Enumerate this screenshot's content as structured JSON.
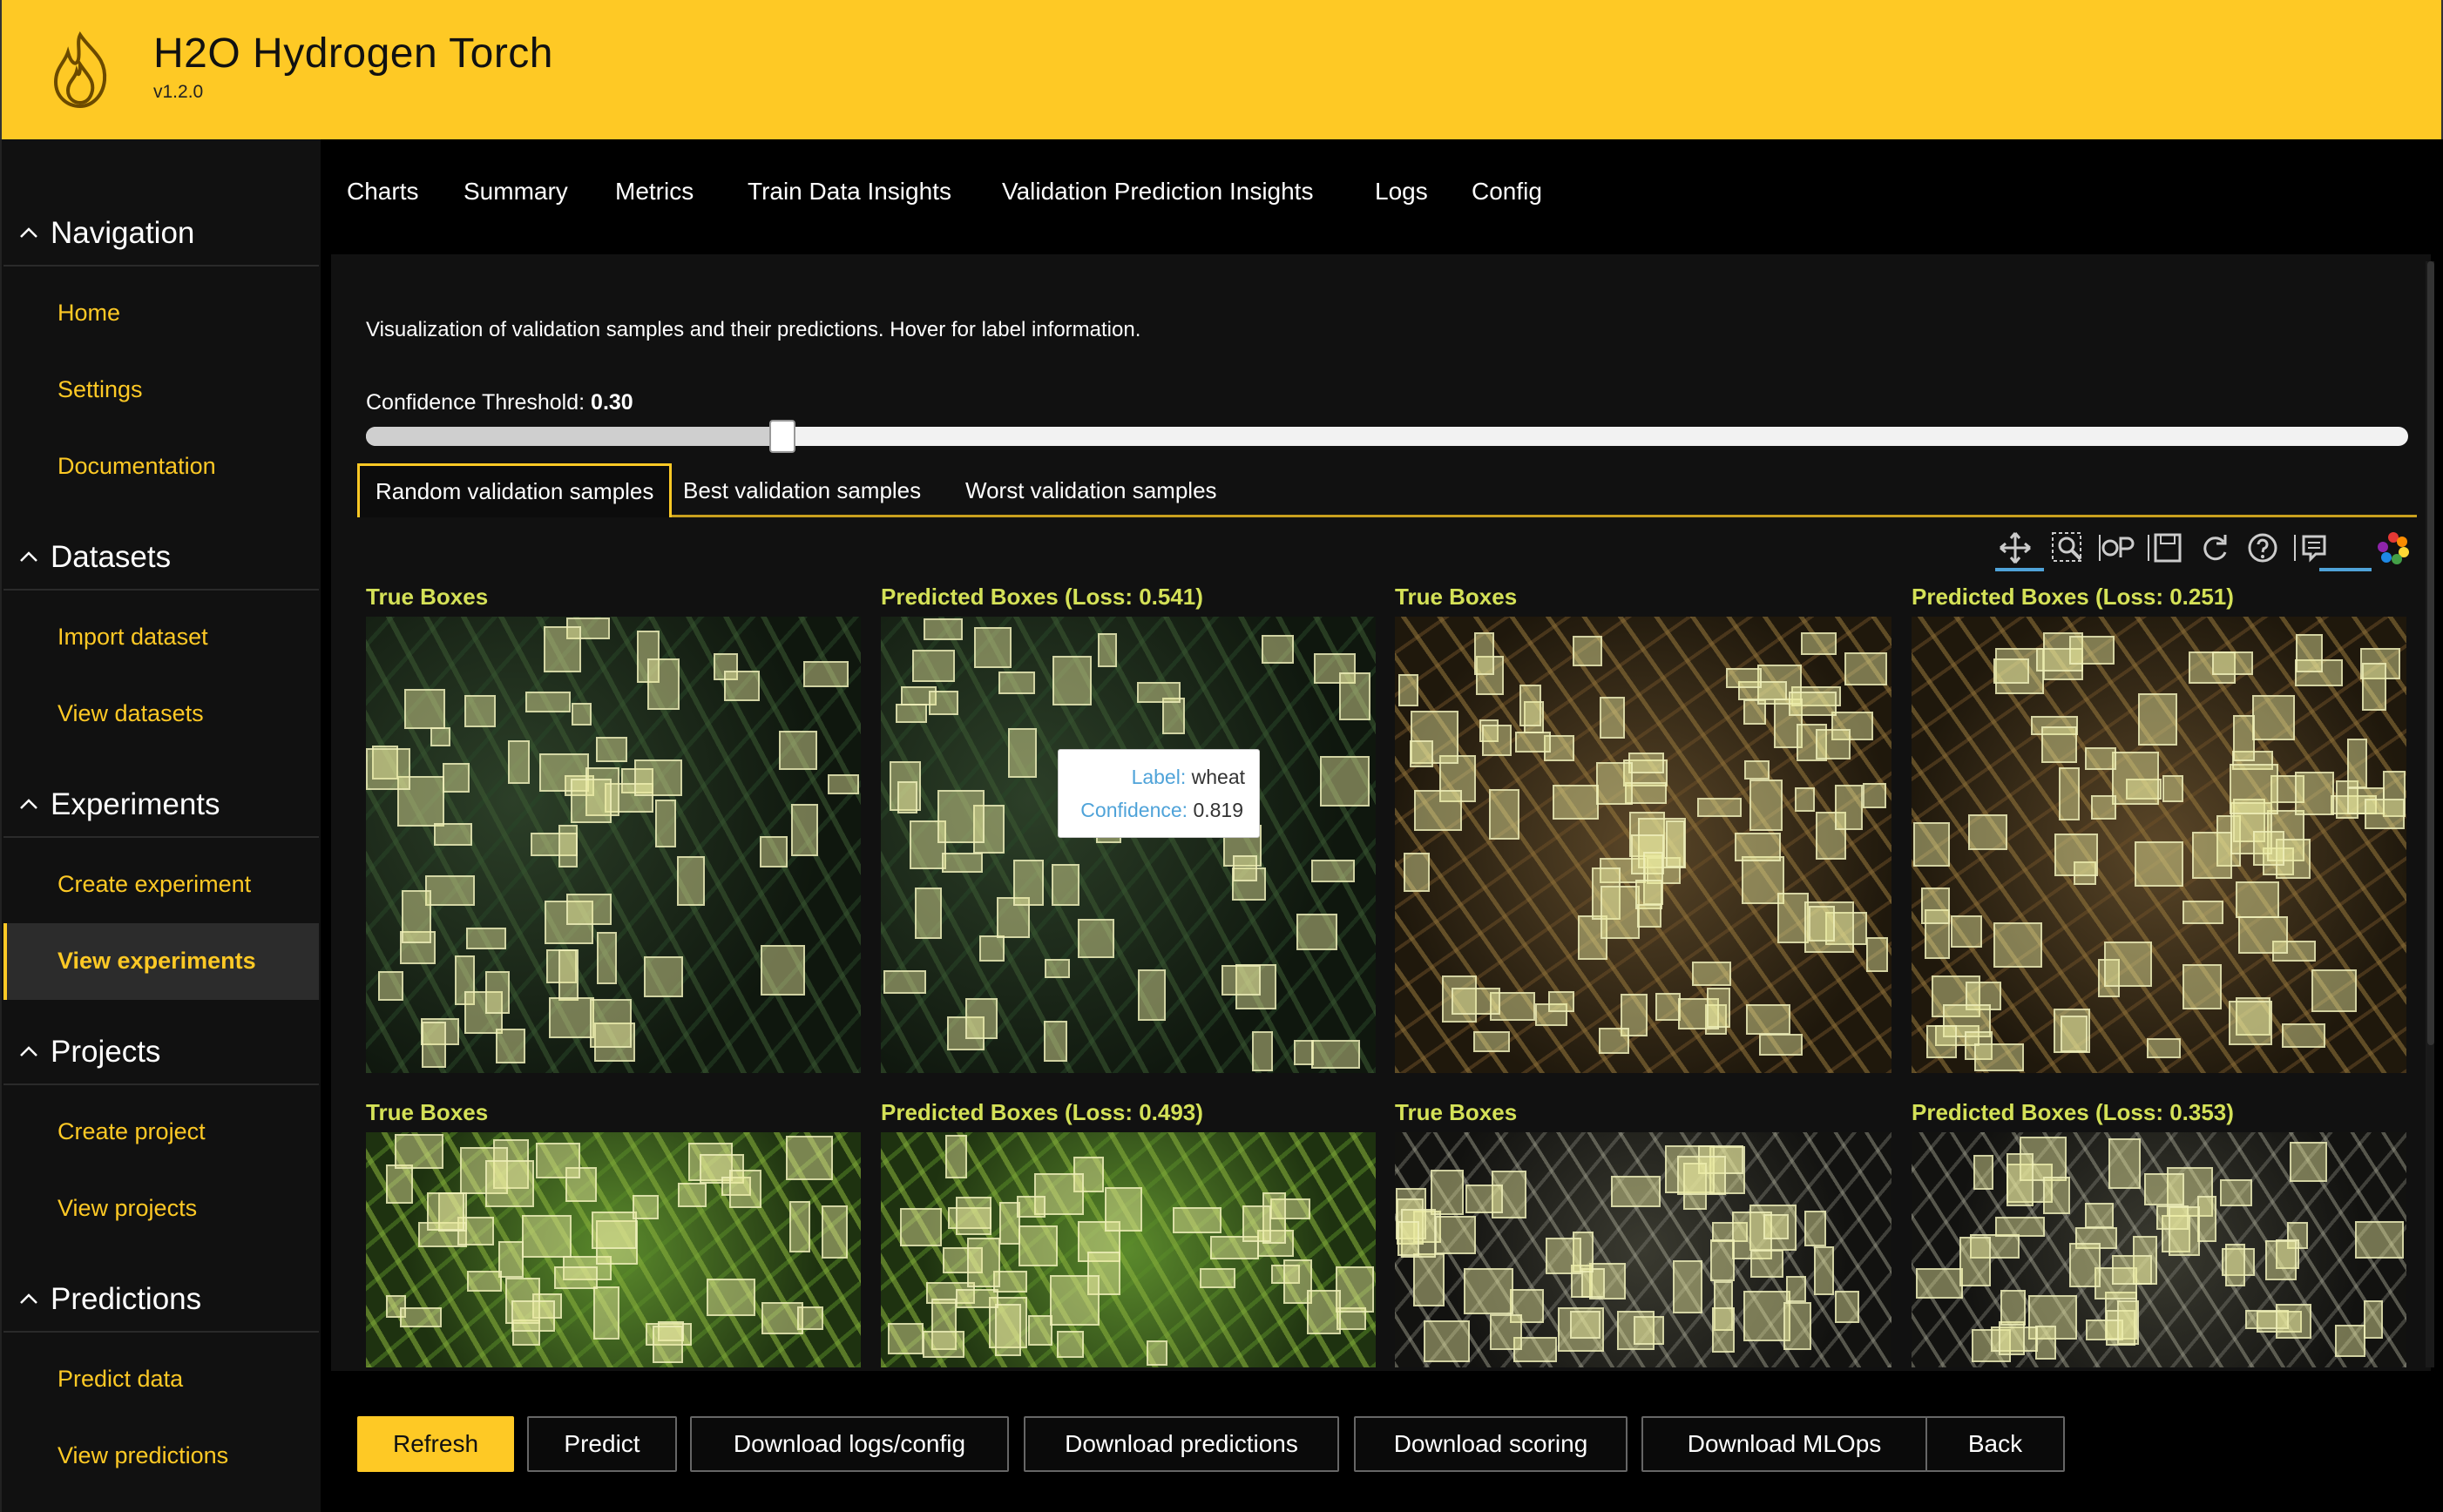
{
  "app": {
    "title": "H2O Hydrogen Torch",
    "version": "v1.2.0"
  },
  "sidebar": {
    "sections": [
      {
        "title": "Navigation",
        "items": [
          "Home",
          "Settings",
          "Documentation"
        ]
      },
      {
        "title": "Datasets",
        "items": [
          "Import dataset",
          "View datasets"
        ]
      },
      {
        "title": "Experiments",
        "items": [
          "Create experiment",
          "View experiments"
        ]
      },
      {
        "title": "Projects",
        "items": [
          "Create project",
          "View projects"
        ]
      },
      {
        "title": "Predictions",
        "items": [
          "Predict data",
          "View predictions"
        ]
      }
    ],
    "active_item": "View experiments"
  },
  "tabs": [
    "Charts",
    "Summary",
    "Metrics",
    "Train Data Insights",
    "Validation Prediction Insights",
    "Logs",
    "Config"
  ],
  "active_tab": "Validation Prediction Insights",
  "main": {
    "description": "Visualization of validation samples and their predictions. Hover for label information.",
    "threshold_label": "Confidence Threshold:",
    "threshold_value": "0.30",
    "threshold_fraction": 0.3,
    "subtabs": [
      "Random validation samples",
      "Best validation samples",
      "Worst validation samples"
    ],
    "active_subtab": "Random validation samples",
    "toolbar_icons": [
      "pan-icon",
      "zoom-icon",
      "zoom-in-out-icon",
      "save-icon",
      "reset-icon",
      "help-icon",
      "hover-icon",
      "plotly-logo-icon"
    ],
    "images": [
      {
        "title": "True Boxes"
      },
      {
        "title": "Predicted Boxes (Loss: 0.541)"
      },
      {
        "title": "True Boxes"
      },
      {
        "title": "Predicted Boxes (Loss: 0.251)"
      },
      {
        "title": "True Boxes"
      },
      {
        "title": "Predicted Boxes (Loss: 0.493)"
      },
      {
        "title": "True Boxes"
      },
      {
        "title": "Predicted Boxes (Loss: 0.353)"
      }
    ],
    "tooltip": {
      "label_key": "Label:",
      "label_value": "wheat",
      "confidence_key": "Confidence:",
      "confidence_value": "0.819"
    }
  },
  "buttons": [
    "Refresh",
    "Predict",
    "Download logs/config",
    "Download predictions",
    "Download scoring",
    "Download MLOps",
    "Back"
  ],
  "colors": {
    "accent": "#fec925",
    "title_green": "#d4e157",
    "link_blue": "#4fa3d9"
  }
}
